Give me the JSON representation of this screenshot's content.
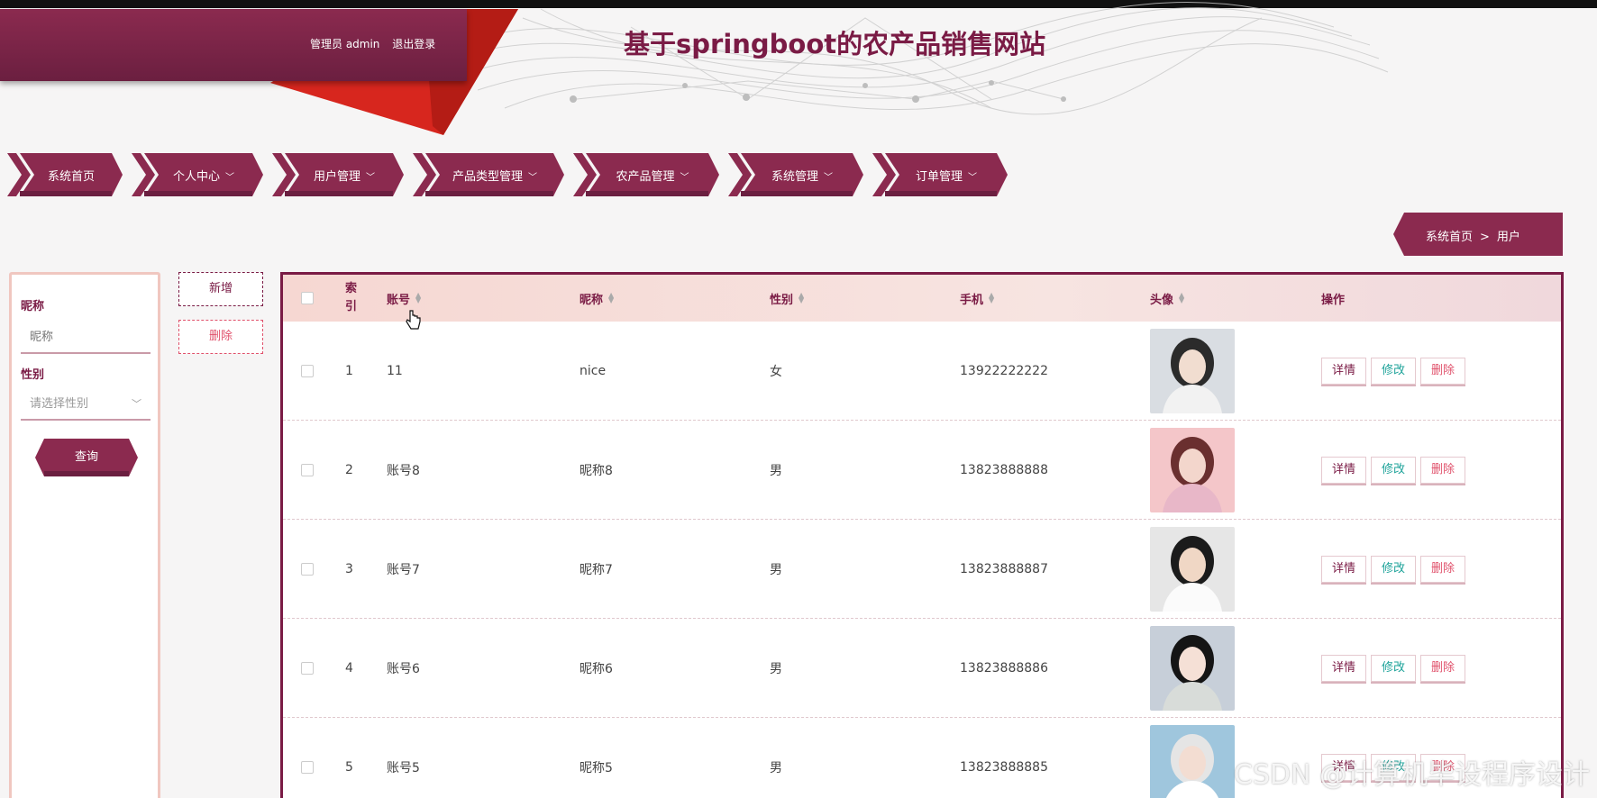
{
  "header": {
    "user_role": "管理员 admin",
    "logout": "退出登录",
    "site_title": "基于springboot的农产品销售网站"
  },
  "nav": {
    "items": [
      {
        "label": "系统首页",
        "dropdown": false
      },
      {
        "label": "个人中心",
        "dropdown": true
      },
      {
        "label": "用户管理",
        "dropdown": true
      },
      {
        "label": "产品类型管理",
        "dropdown": true
      },
      {
        "label": "农产品管理",
        "dropdown": true
      },
      {
        "label": "系统管理",
        "dropdown": true
      },
      {
        "label": "订单管理",
        "dropdown": true
      }
    ]
  },
  "breadcrumb": {
    "home": "系统首页",
    "separator": ">",
    "current": "用户"
  },
  "search": {
    "nickname_label": "昵称",
    "nickname_placeholder": "昵称",
    "gender_label": "性别",
    "gender_placeholder": "请选择性别",
    "query_button": "查询"
  },
  "actions": {
    "add": "新增",
    "delete": "删除"
  },
  "table": {
    "headers": {
      "index": "索引",
      "account": "账号",
      "nickname": "昵称",
      "gender": "性别",
      "phone": "手机",
      "avatar": "头像",
      "ops": "操作"
    },
    "rows": [
      {
        "index": "1",
        "account": "11",
        "nickname": "nice",
        "gender": "女",
        "phone": "13922222222",
        "avatar_icon": "avatar-photo-girl-hanfu"
      },
      {
        "index": "2",
        "account": "账号8",
        "nickname": "昵称8",
        "gender": "男",
        "phone": "13823888888",
        "avatar_icon": "avatar-photo-girl-pink"
      },
      {
        "index": "3",
        "account": "账号7",
        "nickname": "昵称7",
        "gender": "男",
        "phone": "13823888887",
        "avatar_icon": "avatar-photo-boy-white"
      },
      {
        "index": "4",
        "account": "账号6",
        "nickname": "昵称6",
        "gender": "男",
        "phone": "13823888886",
        "avatar_icon": "avatar-photo-girl-black-hair"
      },
      {
        "index": "5",
        "account": "账号5",
        "nickname": "昵称5",
        "gender": "男",
        "phone": "13823888885",
        "avatar_icon": "avatar-photo-girl-helmet"
      }
    ],
    "op_labels": {
      "detail": "详情",
      "edit": "修改",
      "delete": "删除"
    }
  },
  "watermark": "CSDN @计算机毕设程序设计",
  "colors": {
    "primary": "#7a1b45",
    "accent_red": "#d7261e",
    "edit": "#1ea39a",
    "delete": "#e0516b"
  }
}
